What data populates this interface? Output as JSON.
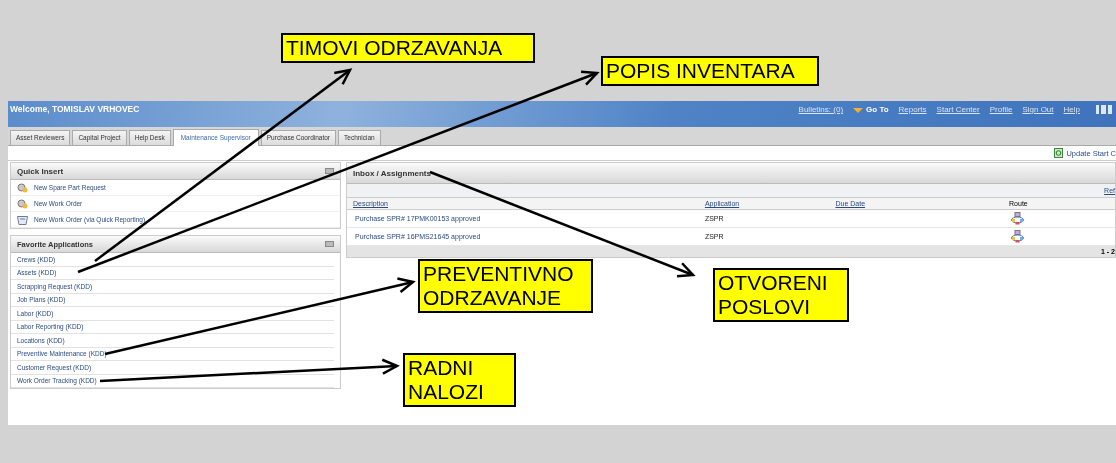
{
  "header": {
    "welcome": "Welcome, TOMISLAV VRHOVEC",
    "links": [
      {
        "label": "Bulletins: (0)",
        "kind": "plain"
      },
      {
        "label": "Go To",
        "kind": "goto"
      },
      {
        "label": "Reports",
        "kind": "plain"
      },
      {
        "label": "Start Center",
        "kind": "plain"
      },
      {
        "label": "Profile",
        "kind": "plain"
      },
      {
        "label": "Sign Out",
        "kind": "plain"
      },
      {
        "label": "Help",
        "kind": "plain"
      }
    ]
  },
  "tabs": [
    {
      "label": "Asset Reviewers",
      "selected": false
    },
    {
      "label": "Capital Project",
      "selected": false
    },
    {
      "label": "Help Desk",
      "selected": false
    },
    {
      "label": "Maintenance Supervisor",
      "selected": true
    },
    {
      "label": "Purchase Coordinator",
      "selected": false
    },
    {
      "label": "Technician",
      "selected": false
    }
  ],
  "toolbar": {
    "update_link": "Update Start C"
  },
  "quick_insert": {
    "title": "Quick Insert",
    "items": [
      {
        "label": "New Spare Part Request",
        "kind": "wizard"
      },
      {
        "label": "New Work Order",
        "kind": "wizard"
      },
      {
        "label": "New Work Order (via Quick Reporting)",
        "kind": "quick"
      }
    ]
  },
  "favorite_applications": {
    "title": "Favorite Applications",
    "items": [
      "Crews (KDD)",
      "Assets (KDD)",
      "Scrapping Request (KDD)",
      "Job Plans (KDD)",
      "Labor (KDD)",
      "Labor Reporting (KDD)",
      "Locations (KDD)",
      "Preventive Maintenance (KDD)",
      "Customer Request (KDD)",
      "Work Order Tracking (KDD)"
    ]
  },
  "inbox": {
    "title": "Inbox / Assignments",
    "refresh": "Ref",
    "columns": [
      "Description",
      "Application",
      "Due Date",
      "Route"
    ],
    "rows": [
      {
        "description": "Purchase SPR# 17PMK00153 approved",
        "application": "ZSPR"
      },
      {
        "description": "Purchase SPR# 16PMS21645 approved",
        "application": "ZSPR"
      }
    ],
    "pagination": "1 - 2"
  },
  "annotations": [
    "TIMOVI ODRZAVANJA",
    "POPIS INVENTARA",
    "PREVENTIVNO ODRZAVANJE",
    "OTVORENI POSLOVI",
    "RADNI NALOZI"
  ]
}
